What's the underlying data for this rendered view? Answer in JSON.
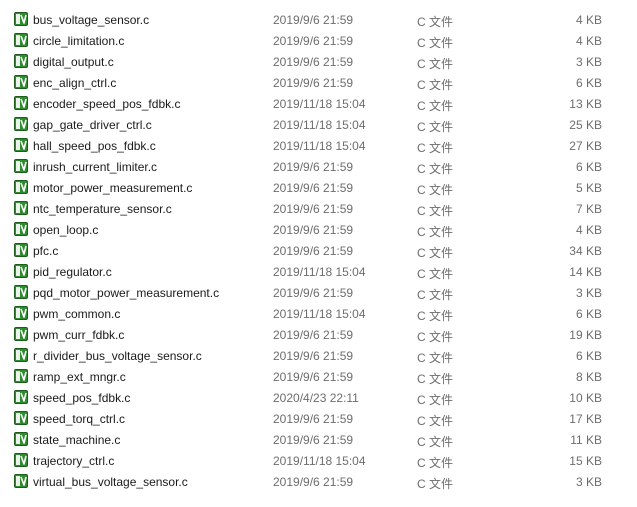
{
  "icon": "c-source-file-icon",
  "colors": {
    "icon_green": "#2e8b2e",
    "icon_dark": "#1d5e1d",
    "meta_text": "#6d6d6d"
  },
  "files": [
    {
      "name": "bus_voltage_sensor.c",
      "date": "2019/9/6 21:59",
      "type": "C 文件",
      "size": "4 KB"
    },
    {
      "name": "circle_limitation.c",
      "date": "2019/9/6 21:59",
      "type": "C 文件",
      "size": "4 KB"
    },
    {
      "name": "digital_output.c",
      "date": "2019/9/6 21:59",
      "type": "C 文件",
      "size": "3 KB"
    },
    {
      "name": "enc_align_ctrl.c",
      "date": "2019/9/6 21:59",
      "type": "C 文件",
      "size": "6 KB"
    },
    {
      "name": "encoder_speed_pos_fdbk.c",
      "date": "2019/11/18 15:04",
      "type": "C 文件",
      "size": "13 KB"
    },
    {
      "name": "gap_gate_driver_ctrl.c",
      "date": "2019/11/18 15:04",
      "type": "C 文件",
      "size": "25 KB"
    },
    {
      "name": "hall_speed_pos_fdbk.c",
      "date": "2019/11/18 15:04",
      "type": "C 文件",
      "size": "27 KB"
    },
    {
      "name": "inrush_current_limiter.c",
      "date": "2019/9/6 21:59",
      "type": "C 文件",
      "size": "6 KB"
    },
    {
      "name": "motor_power_measurement.c",
      "date": "2019/9/6 21:59",
      "type": "C 文件",
      "size": "5 KB"
    },
    {
      "name": "ntc_temperature_sensor.c",
      "date": "2019/9/6 21:59",
      "type": "C 文件",
      "size": "7 KB"
    },
    {
      "name": "open_loop.c",
      "date": "2019/9/6 21:59",
      "type": "C 文件",
      "size": "4 KB"
    },
    {
      "name": "pfc.c",
      "date": "2019/9/6 21:59",
      "type": "C 文件",
      "size": "34 KB"
    },
    {
      "name": "pid_regulator.c",
      "date": "2019/11/18 15:04",
      "type": "C 文件",
      "size": "14 KB"
    },
    {
      "name": "pqd_motor_power_measurement.c",
      "date": "2019/9/6 21:59",
      "type": "C 文件",
      "size": "3 KB"
    },
    {
      "name": "pwm_common.c",
      "date": "2019/11/18 15:04",
      "type": "C 文件",
      "size": "6 KB"
    },
    {
      "name": "pwm_curr_fdbk.c",
      "date": "2019/9/6 21:59",
      "type": "C 文件",
      "size": "19 KB"
    },
    {
      "name": "r_divider_bus_voltage_sensor.c",
      "date": "2019/9/6 21:59",
      "type": "C 文件",
      "size": "6 KB"
    },
    {
      "name": "ramp_ext_mngr.c",
      "date": "2019/9/6 21:59",
      "type": "C 文件",
      "size": "8 KB"
    },
    {
      "name": "speed_pos_fdbk.c",
      "date": "2020/4/23 22:11",
      "type": "C 文件",
      "size": "10 KB"
    },
    {
      "name": "speed_torq_ctrl.c",
      "date": "2019/9/6 21:59",
      "type": "C 文件",
      "size": "17 KB"
    },
    {
      "name": "state_machine.c",
      "date": "2019/9/6 21:59",
      "type": "C 文件",
      "size": "11 KB"
    },
    {
      "name": "trajectory_ctrl.c",
      "date": "2019/11/18 15:04",
      "type": "C 文件",
      "size": "15 KB"
    },
    {
      "name": "virtual_bus_voltage_sensor.c",
      "date": "2019/9/6 21:59",
      "type": "C 文件",
      "size": "3 KB"
    }
  ]
}
